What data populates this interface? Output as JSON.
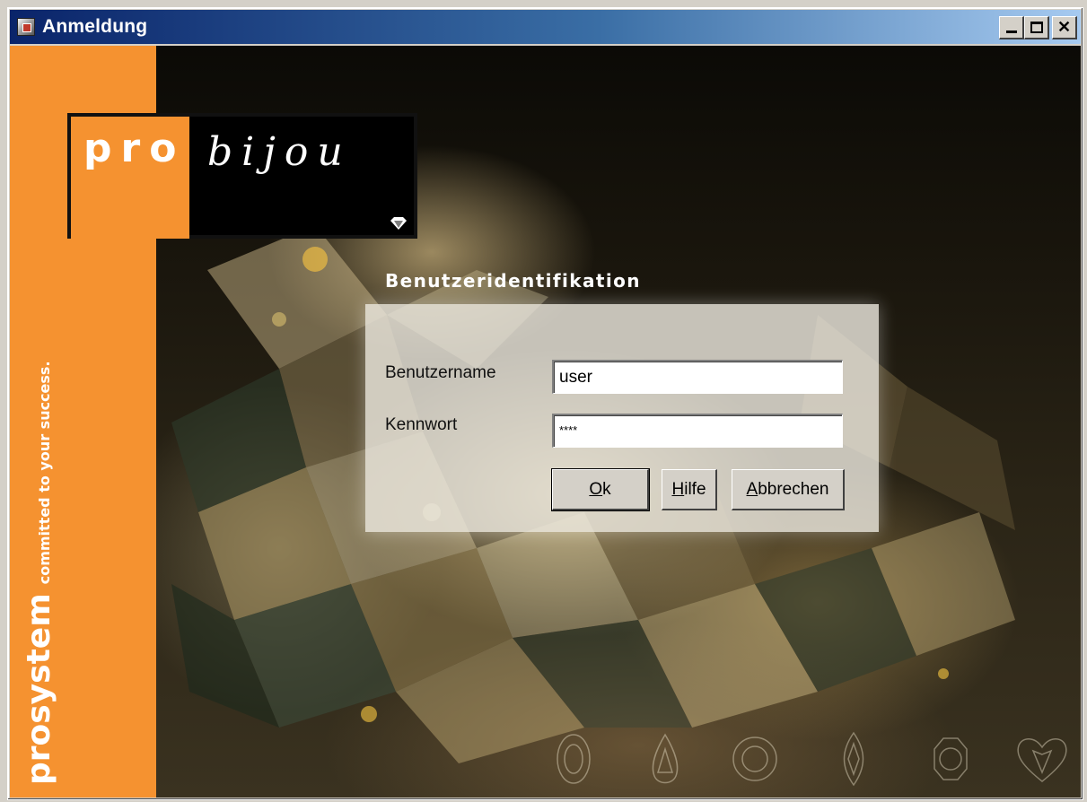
{
  "window": {
    "title": "Anmeldung",
    "controls": {
      "minimize": "minimize",
      "maximize": "maximize",
      "close": "close"
    }
  },
  "branding": {
    "logo_pro": "pro",
    "logo_bijou": "bijou",
    "sidebar_brand": "prosystem",
    "sidebar_tagline": "committed to your success.",
    "accent_color": "#f59230"
  },
  "login": {
    "heading": "Benutzeridentifikation",
    "username_label": "Benutzername",
    "username_value": "user",
    "password_label": "Kennwort",
    "password_value": "****",
    "buttons": {
      "ok": {
        "mnemonic": "O",
        "rest": "k"
      },
      "help": {
        "mnemonic": "H",
        "rest": "ilfe"
      },
      "cancel": {
        "mnemonic": "A",
        "rest": "bbrechen"
      }
    }
  },
  "icons": [
    "app-cube-icon",
    "diamond-logo-icon",
    "oval-cut-icon",
    "pear-cut-icon",
    "round-cut-icon",
    "marquise-cut-icon",
    "octagon-cut-icon",
    "heart-cut-icon"
  ]
}
